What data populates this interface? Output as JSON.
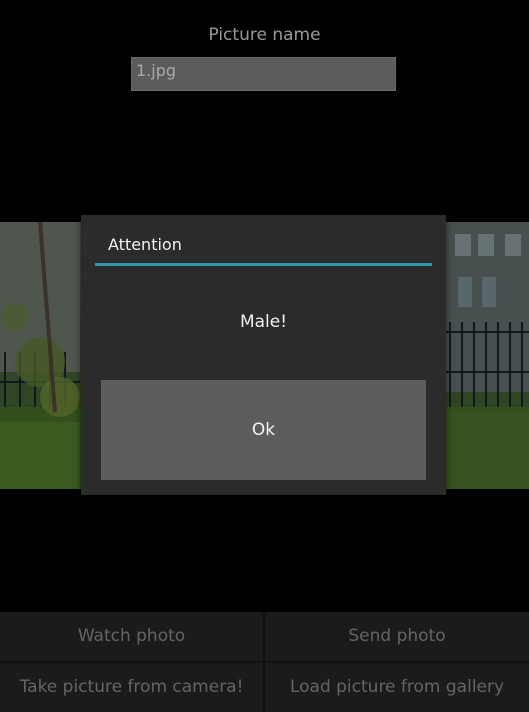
{
  "picture": {
    "label": "Picture name",
    "filename": "1.jpg"
  },
  "bottom_buttons": {
    "watch": "Watch photo",
    "send": "Send photo",
    "take": "Take picture from camera!",
    "load": "Load picture from gallery"
  },
  "dialog": {
    "title": "Attention",
    "message": "Male!",
    "ok_label": "Ok",
    "accent": "#2b97b0"
  },
  "colors": {
    "background": "#000000",
    "dialog_bg": "#2b2b2b",
    "button_bg": "#5c5c5c"
  }
}
